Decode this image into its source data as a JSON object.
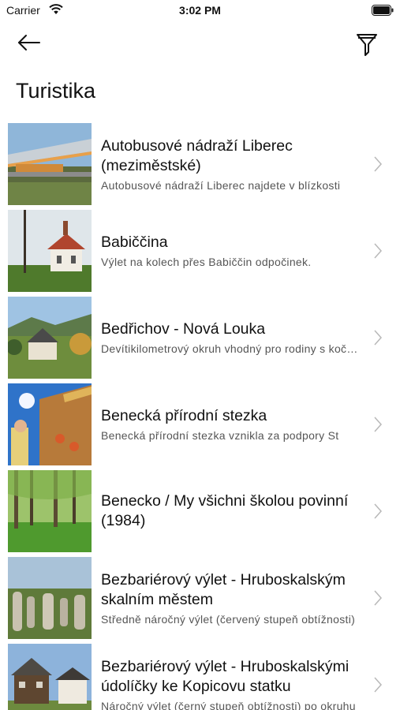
{
  "status_bar": {
    "carrier": "Carrier",
    "time": "3:02 PM"
  },
  "nav": {
    "back_icon": "arrow-left-icon",
    "filter_icon": "filter-icon"
  },
  "page": {
    "title": "Turistika"
  },
  "items": [
    {
      "title": "Autobusové nádraží Liberec (meziměstské)",
      "subtitle": "Autobusové nádraží Liberec najdete v blízkosti",
      "thumbnail": "bus-station-photo"
    },
    {
      "title": "Babiččina",
      "subtitle": "Výlet na kolech přes Babiččin odpočinek.",
      "thumbnail": "chapel-photo"
    },
    {
      "title": "Bedřichov - Nová Louka",
      "subtitle": "Devítikilometrový okruh vhodný pro rodiny s kočárky",
      "thumbnail": "mountain-house-photo"
    },
    {
      "title": "Benecká přírodní stezka",
      "subtitle": "Benecká přírodní stezka vznikla za podpory St",
      "thumbnail": "nature-trail-photo"
    },
    {
      "title": "Benecko / My všichni školou povinní (1984)",
      "subtitle": "",
      "thumbnail": "forest-photo"
    },
    {
      "title": "Bezbariérový výlet - Hruboskalským skalním městem",
      "subtitle": "Středně náročný výlet (červený stupeň obtížnosti)",
      "thumbnail": "rock-town-photo"
    },
    {
      "title": "Bezbariérový výlet - Hruboskalskými údolíčky ke Kopicovu statku",
      "subtitle": "Náročný výlet (černý stupeň obtížnosti) po okruhu",
      "thumbnail": "timber-house-photo"
    }
  ]
}
